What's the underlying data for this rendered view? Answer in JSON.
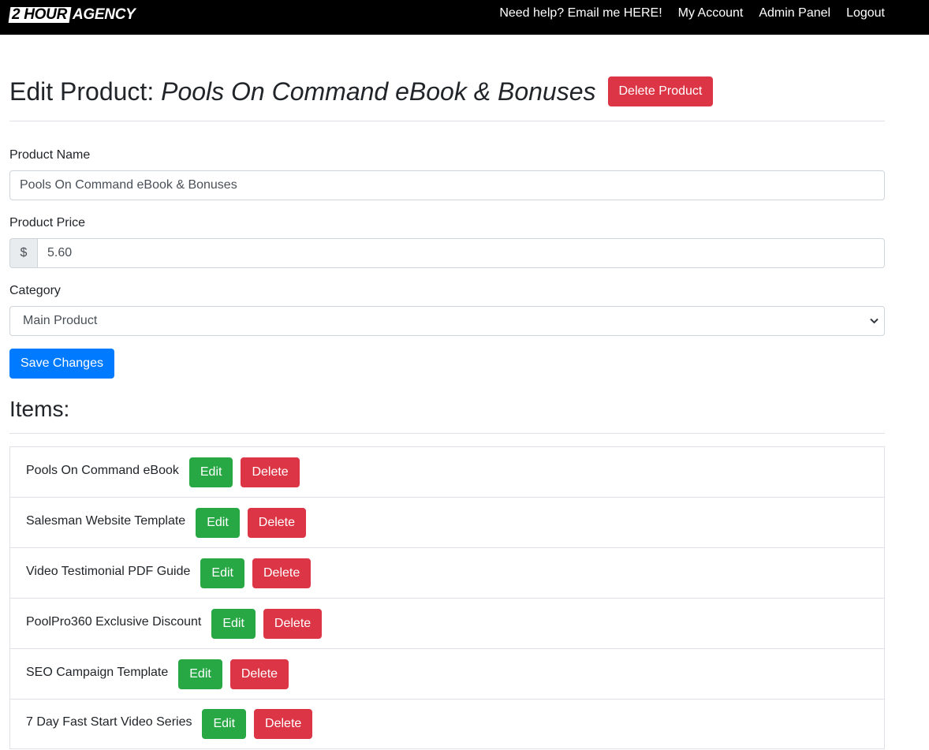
{
  "brand": {
    "logo_box_text": "2 HOUR",
    "logo_text": "AGENCY"
  },
  "nav": {
    "help": "Need help? Email me HERE!",
    "account": "My Account",
    "admin": "Admin Panel",
    "logout": "Logout"
  },
  "header": {
    "title_prefix": "Edit Product:",
    "product_name": "Pools On Command eBook & Bonuses",
    "delete_label": "Delete Product"
  },
  "form": {
    "name_label": "Product Name",
    "name_value": "Pools On Command eBook & Bonuses",
    "price_label": "Product Price",
    "currency_symbol": "$",
    "price_value": "5.60",
    "category_label": "Category",
    "category_value": "Main Product",
    "save_label": "Save Changes"
  },
  "items_section": {
    "heading": "Items:",
    "edit_label": "Edit",
    "delete_label": "Delete",
    "items": [
      {
        "name": "Pools On Command eBook"
      },
      {
        "name": "Salesman Website Template"
      },
      {
        "name": "Video Testimonial PDF Guide"
      },
      {
        "name": "PoolPro360 Exclusive Discount"
      },
      {
        "name": "SEO Campaign Template"
      },
      {
        "name": "7 Day Fast Start Video Series"
      }
    ]
  },
  "colors": {
    "danger": "#dc3545",
    "success": "#28a745",
    "primary": "#007bff",
    "topbar": "#000000"
  }
}
